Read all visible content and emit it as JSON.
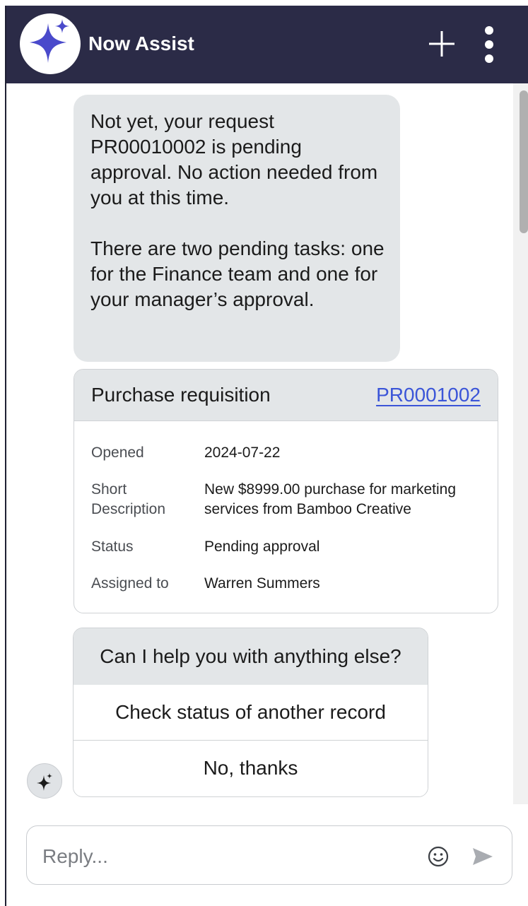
{
  "header": {
    "title": "Now Assist"
  },
  "messages": {
    "bot_reply": {
      "paragraph_1": "Not yet, your request PR00010002 is pending approval. No action needed from you at this time.",
      "paragraph_2": "There are two pending tasks: one for the Finance team and one for your manager’s approval."
    }
  },
  "record_card": {
    "title": "Purchase requisition",
    "record_number": "PR0001002",
    "fields": [
      {
        "label": "Opened",
        "value": "2024-07-22"
      },
      {
        "label_line_1": "Short",
        "label_line_2": "Description",
        "value_line_1": "New $8999.00 purchase for marketing",
        "value_line_2": "services from Bamboo Creative"
      },
      {
        "label": "Status",
        "value": "Pending approval"
      },
      {
        "label": "Assigned to",
        "value": "Warren Summers"
      }
    ]
  },
  "followup": {
    "prompt": "Can I help you with anything else?",
    "options": [
      {
        "label": "Check status of another record"
      },
      {
        "label": "No, thanks"
      }
    ]
  },
  "composer": {
    "placeholder": "Reply..."
  },
  "colors": {
    "header_bg": "#2b2b47",
    "bubble_bg": "#e3e6e8",
    "link": "#3b55d8",
    "logo_star": "#4a4acb"
  },
  "icons": {
    "logo": "sparkle-icon",
    "new_chat": "plus-icon",
    "more": "more-vertical-icon",
    "bot_avatar": "sparkle-icon",
    "emoji": "smiley-icon",
    "send": "send-icon"
  }
}
